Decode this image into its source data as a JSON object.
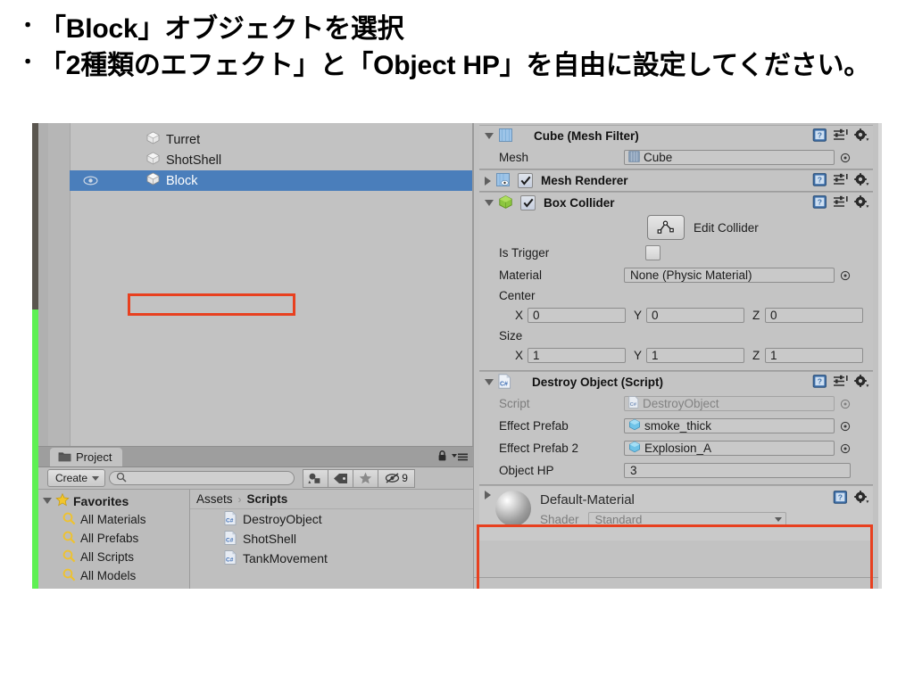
{
  "slide": {
    "bullets": [
      "「Block」オブジェクトを選択",
      "「2種類のエフェクト」と「Object HP」を自由に設定してください。"
    ],
    "bullet_marker": "・"
  },
  "colors": {
    "selection_blue": "#4a7ebb",
    "highlight_red": "#e8401f",
    "panel_gray": "#c2c2c2",
    "accent_green": "#5ef053"
  },
  "hierarchy": {
    "items": [
      {
        "label": "Turret",
        "icon": "cube-icon",
        "selected": false
      },
      {
        "label": "ShotShell",
        "icon": "cube-icon",
        "selected": false
      },
      {
        "label": "Block",
        "icon": "cube-icon",
        "selected": true
      }
    ]
  },
  "project": {
    "tab_label": "Project",
    "tab_icon": "folder-icon",
    "lock_icon": "lock-icon",
    "menu_icon": "panel-menu-icon",
    "create_label": "Create",
    "search_placeholder": "",
    "search_value": "",
    "filter_icons": [
      {
        "name": "type-filter-icon",
        "label": ""
      },
      {
        "name": "label-filter-icon",
        "label": ""
      },
      {
        "name": "favorite-star-icon",
        "label": ""
      },
      {
        "name": "hidden-assets-icon",
        "label": "9"
      }
    ],
    "favorites": {
      "header": "Favorites",
      "items": [
        "All Materials",
        "All Prefabs",
        "All Scripts",
        "All Models"
      ]
    },
    "breadcrumb": {
      "root": "Assets",
      "separator": "›",
      "current": "Scripts"
    },
    "assets": [
      {
        "label": "DestroyObject",
        "icon": "csharp-script-icon"
      },
      {
        "label": "ShotShell",
        "icon": "csharp-script-icon"
      },
      {
        "label": "TankMovement",
        "icon": "csharp-script-icon"
      }
    ]
  },
  "inspector": {
    "mesh_filter": {
      "title": "Cube (Mesh Filter)",
      "icon": "mesh-filter-icon",
      "mesh_label": "Mesh",
      "mesh_value": "Cube"
    },
    "mesh_renderer": {
      "title": "Mesh Renderer",
      "icon": "mesh-renderer-icon",
      "enabled": true
    },
    "box_collider": {
      "title": "Box Collider",
      "icon": "box-collider-icon",
      "enabled": true,
      "edit_collider_label": "Edit Collider",
      "is_trigger_label": "Is Trigger",
      "is_trigger_value": false,
      "material_label": "Material",
      "material_value": "None (Physic Material)",
      "center_label": "Center",
      "center": {
        "x": "0",
        "y": "0",
        "z": "0"
      },
      "size_label": "Size",
      "size": {
        "x": "1",
        "y": "1",
        "z": "1"
      },
      "axis_x": "X",
      "axis_y": "Y",
      "axis_z": "Z"
    },
    "destroy_object": {
      "title": "Destroy Object (Script)",
      "icon": "csharp-script-icon",
      "script_label": "Script",
      "script_value": "DestroyObject",
      "effect_prefab_label": "Effect Prefab",
      "effect_prefab_value": "smoke_thick",
      "effect_prefab2_label": "Effect Prefab 2",
      "effect_prefab2_value": "Explosion_A",
      "object_hp_label": "Object HP",
      "object_hp_value": "3"
    },
    "material": {
      "name": "Default-Material",
      "shader_label": "Shader",
      "shader_value": "Standard"
    },
    "header_icons": {
      "help": "help-book-icon",
      "preset": "preset-icon",
      "settings": "gear-icon"
    }
  }
}
